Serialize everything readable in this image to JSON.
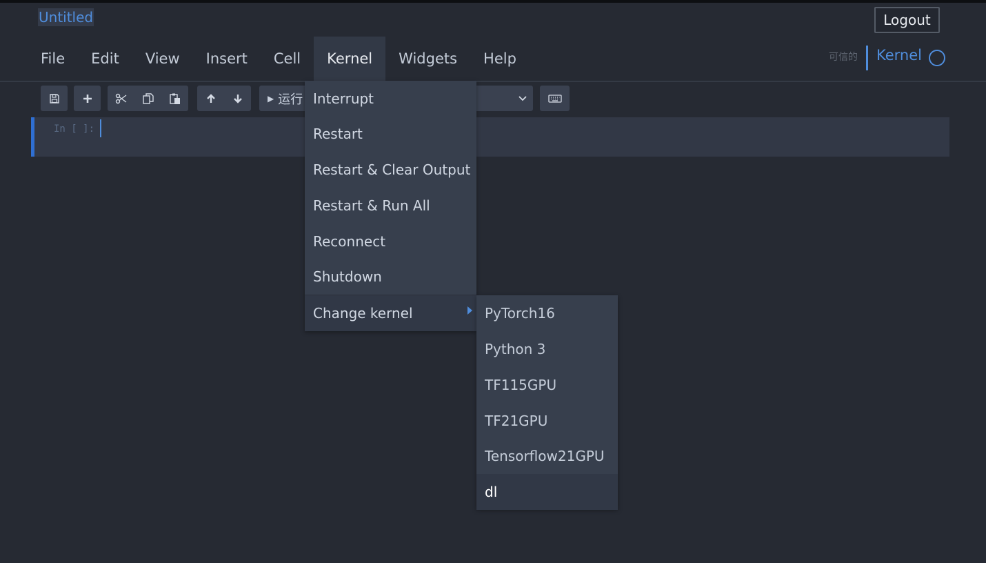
{
  "notebook": {
    "title": "Untitled"
  },
  "header": {
    "logout_label": "Logout",
    "trusted_label": "可信的",
    "kernel_label": "Kernel"
  },
  "menubar": {
    "items": [
      {
        "label": "File"
      },
      {
        "label": "Edit"
      },
      {
        "label": "View"
      },
      {
        "label": "Insert"
      },
      {
        "label": "Cell"
      },
      {
        "label": "Kernel"
      },
      {
        "label": "Widgets"
      },
      {
        "label": "Help"
      }
    ]
  },
  "toolbar": {
    "run_label": "运行",
    "icons": [
      "save-icon",
      "plus-icon",
      "scissors-icon",
      "copy-icon",
      "paste-icon",
      "arrow-up-icon",
      "arrow-down-icon",
      "chevron-down-icon",
      "keyboard-icon"
    ]
  },
  "cell": {
    "prompt": "In [ ]:"
  },
  "kernel_menu": {
    "items": [
      {
        "label": "Interrupt"
      },
      {
        "label": "Restart"
      },
      {
        "label": "Restart & Clear Output"
      },
      {
        "label": "Restart & Run All"
      },
      {
        "label": "Reconnect"
      },
      {
        "label": "Shutdown"
      },
      {
        "label": "Change kernel"
      }
    ]
  },
  "change_kernel_submenu": {
    "items": [
      {
        "label": "PyTorch16"
      },
      {
        "label": "Python 3"
      },
      {
        "label": "TF115GPU"
      },
      {
        "label": "TF21GPU"
      },
      {
        "label": "Tensorflow21GPU"
      },
      {
        "label": "dl"
      }
    ]
  },
  "colors": {
    "accent": "#4f8ddc",
    "background": "#262a33",
    "menu_bg": "#373f4d",
    "cell_border": "#2f6fd3"
  }
}
